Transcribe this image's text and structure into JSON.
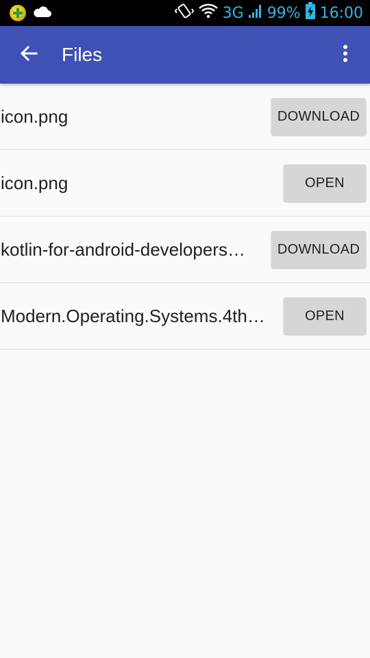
{
  "status_bar": {
    "network": "3G",
    "battery": "99%",
    "time": "16:00"
  },
  "toolbar": {
    "title": "Files"
  },
  "files": [
    {
      "name": "icon.png",
      "action": "DOWNLOAD"
    },
    {
      "name": "icon.png",
      "action": "OPEN"
    },
    {
      "name": "kotlin-for-android-developers…",
      "action": "DOWNLOAD"
    },
    {
      "name": "Modern.Operating.Systems.4th…",
      "action": "OPEN"
    }
  ],
  "colors": {
    "app_bar": "#3f51b5",
    "status_accent": "#33b5e5",
    "button_bg": "#d6d6d6"
  }
}
